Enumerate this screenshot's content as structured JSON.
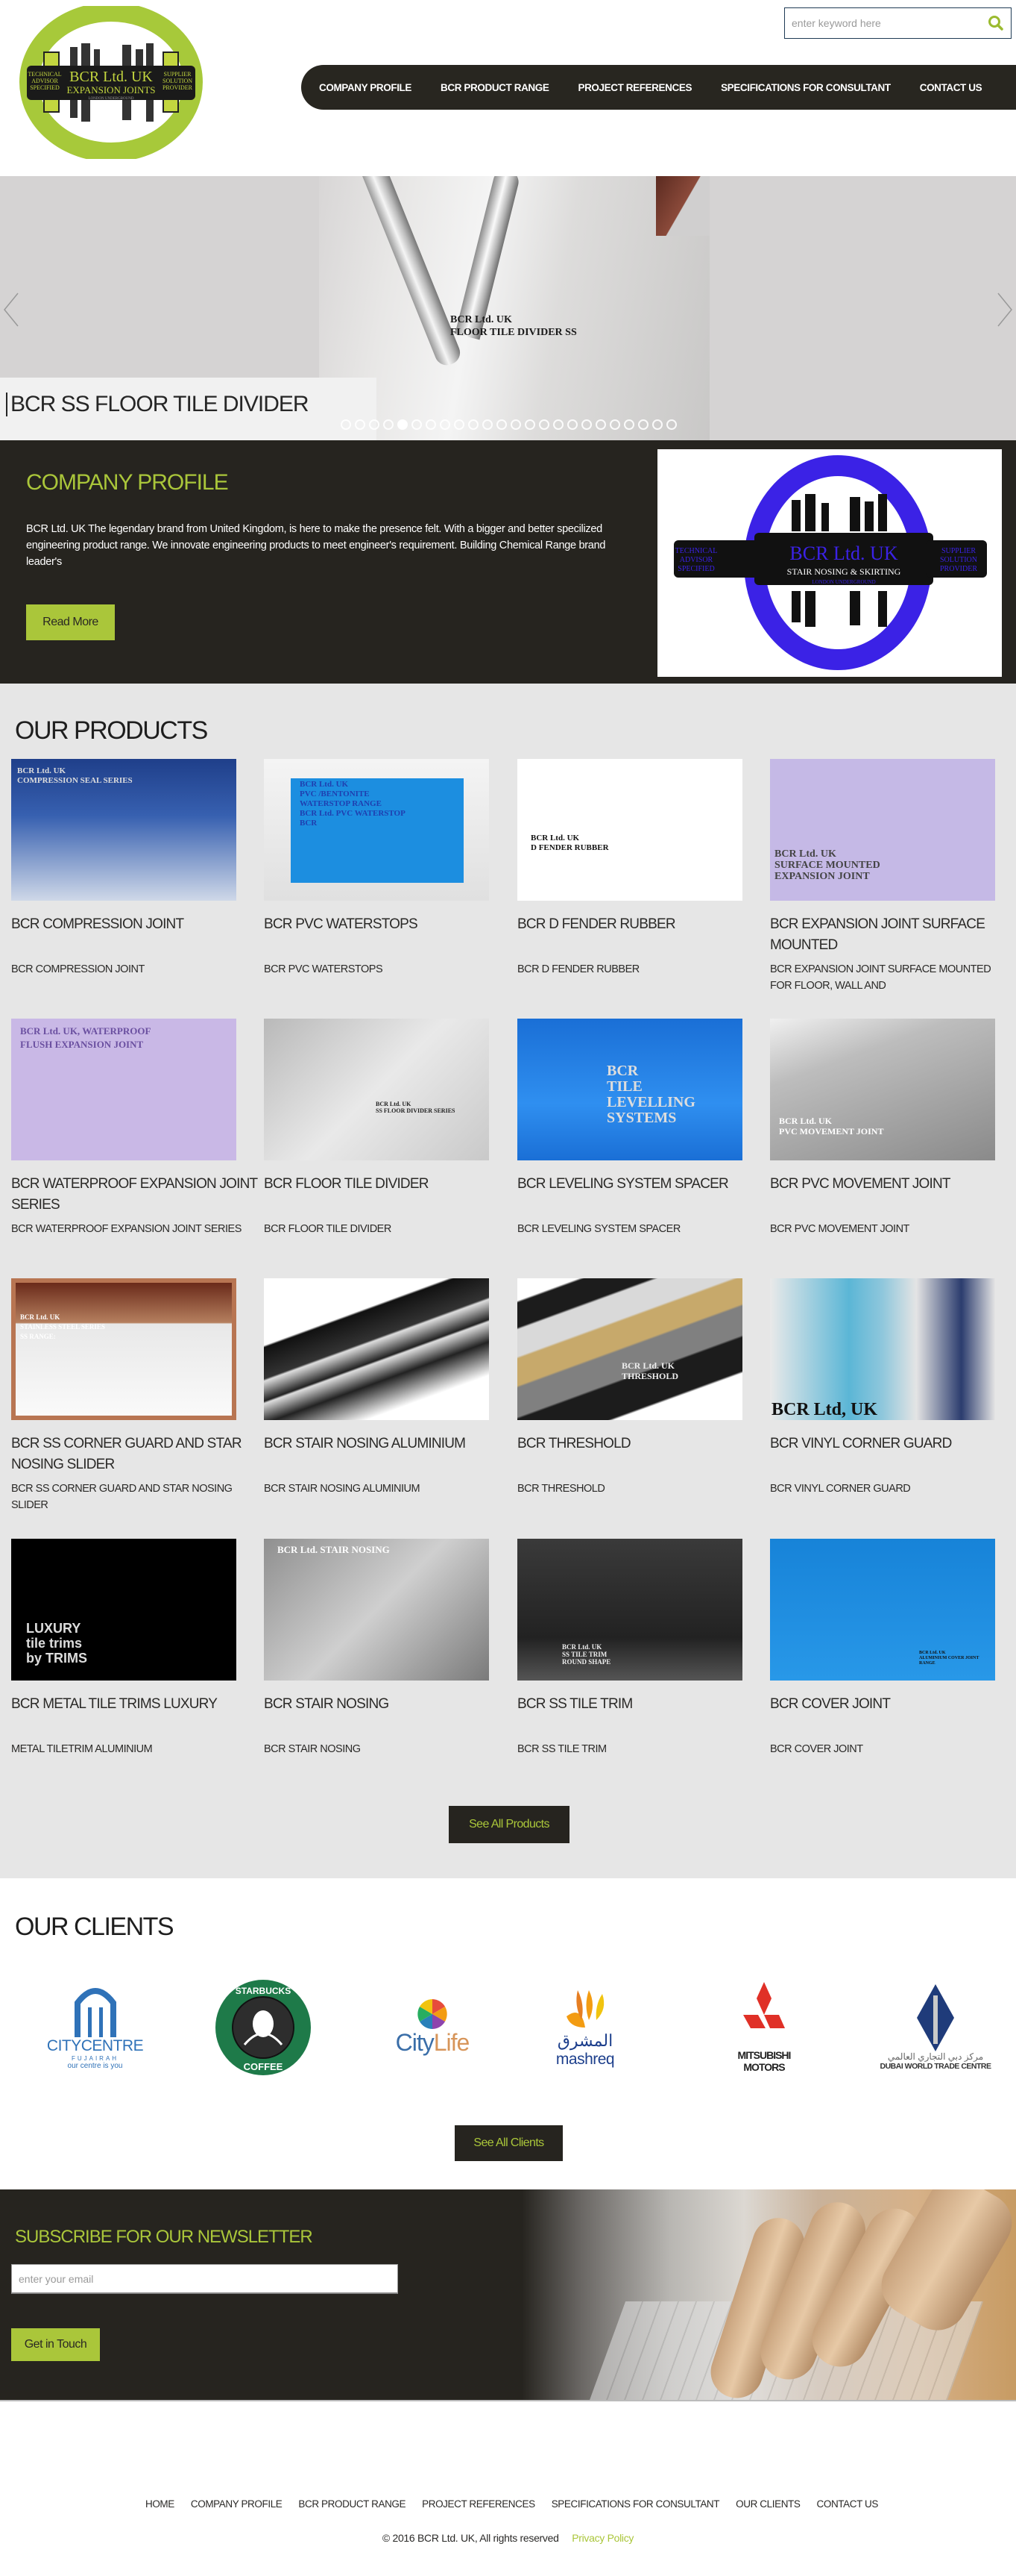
{
  "header": {
    "logo": {
      "title": "BCR Ltd. UK",
      "subtitle": "EXPANSION JOINTS",
      "tagline": "LONDON UNDERGROUND",
      "left_text": [
        "TECHNICAL",
        "ADVISOR",
        "SPECIFIED"
      ],
      "right_text": [
        "SUPPLIER",
        "SOLUTION",
        "PROVIDER"
      ]
    },
    "search": {
      "placeholder": "enter keyword here",
      "icon": "search-icon"
    },
    "nav": [
      {
        "label": "COMPANY PROFILE"
      },
      {
        "label": "BCR PRODUCT RANGE"
      },
      {
        "label": "PROJECT REFERENCES"
      },
      {
        "label": "SPECIFICATIONS FOR CONSULTANT"
      },
      {
        "label": "CONTACT US"
      }
    ]
  },
  "slider": {
    "image_text": [
      "BCR Ltd. UK",
      "FLOOR TILE DIVIDER SS"
    ],
    "caption": "BCR SS FLOOR TILE DIVIDER",
    "prev_icon": "chevron-left-icon",
    "next_icon": "chevron-right-icon",
    "dot_count": 24,
    "active_dot": 4
  },
  "profile": {
    "title": "COMPANY PROFILE",
    "text": "BCR Ltd. UK The legendary brand from United Kingdom, is here to make the presence felt. With a bigger and better specilized engineering product range. We innovate engineering products to meet engineer's requirement. Building Chemical Range brand leader's",
    "button": "Read More",
    "logo": {
      "title": "BCR Ltd. UK",
      "subtitle": "STAIR NOSING & SKIRTING",
      "tagline": "LONDON UNDERGROUND",
      "left_text": [
        "TECHNICAL",
        "ADVISOR",
        "SPECIFIED"
      ],
      "right_text": [
        "SUPPLIER",
        "SOLUTION",
        "PROVIDER"
      ]
    }
  },
  "products": {
    "title": "OUR PRODUCTS",
    "items": [
      {
        "title": "BCR COMPRESSION JOINT",
        "desc": "BCR COMPRESSION JOINT",
        "img_text": [
          "BCR Ltd. UK",
          "COMPRESSION SEAL SERIES"
        ]
      },
      {
        "title": "BCR PVC WATERSTOPS",
        "desc": "BCR PVC WATERSTOPS",
        "img_text": [
          "BCR Ltd. UK",
          "PVC /BENTONITE",
          "WATERSTOP RANGE",
          "BCR Ltd. PVC WATERSTOP",
          "BCR"
        ]
      },
      {
        "title": "BCR D FENDER RUBBER",
        "desc": "BCR D FENDER RUBBER",
        "img_text": [
          "BCR Ltd. UK",
          "D FENDER RUBBER"
        ]
      },
      {
        "title": "BCR EXPANSION JOINT SURFACE MOUNTED",
        "desc": "BCR EXPANSION JOINT SURFACE MOUNTED FOR FLOOR, WALL AND",
        "img_text": [
          "BCR Ltd. UK",
          "SURFACE MOUNTED",
          "EXPANSION JOINT"
        ]
      },
      {
        "title": "BCR WATERPROOF EXPANSION JOINT SERIES",
        "desc": "BCR WATERPROOF EXPANSION JOINT SERIES",
        "img_text": [
          "BCR Ltd. UK, WATERPROOF",
          "FLUSH EXPANSION JOINT"
        ]
      },
      {
        "title": "BCR FLOOR TILE DIVIDER",
        "desc": "BCR FLOOR TILE DIVIDER",
        "img_text": [
          "BCR Ltd. UK",
          "SS FLOOR DIVIDER SERIES"
        ]
      },
      {
        "title": "BCR LEVELING SYSTEM SPACER",
        "desc": "BCR LEVELING SYSTEM SPACER",
        "img_text": [
          "BCR",
          "TILE",
          "LEVELLING",
          "SYSTEMS"
        ]
      },
      {
        "title": "BCR PVC MOVEMENT JOINT",
        "desc": "BCR PVC MOVEMENT JOINT",
        "img_text": [
          "BCR Ltd. UK",
          "PVC MOVEMENT JOINT"
        ]
      },
      {
        "title": "BCR SS CORNER GUARD AND STAR NOSING SLIDER",
        "desc": "BCR SS CORNER GUARD AND STAR NOSING SLIDER",
        "img_text": [
          "BCR Ltd. UK",
          "STAINLESS STEEL SERIES",
          "SS RANGE:"
        ]
      },
      {
        "title": "BCR STAIR NOSING ALUMINIUM",
        "desc": "BCR STAIR NOSING ALUMINIUM",
        "img_text": []
      },
      {
        "title": "BCR THRESHOLD",
        "desc": "BCR THRESHOLD",
        "img_text": [
          "BCR Ltd. UK",
          "THRESHOLD"
        ]
      },
      {
        "title": "BCR VINYL CORNER GUARD",
        "desc": "BCR VINYL CORNER GUARD",
        "img_text": [
          "BCR Ltd, UK"
        ]
      },
      {
        "title": "BCR METAL TILE TRIMS LUXURY",
        "desc": "METAL TILETRIM ALUMINIUM",
        "img_text": [
          "LUXURY",
          "tile trims",
          "by TRIMS"
        ]
      },
      {
        "title": "BCR STAIR NOSING",
        "desc": "BCR STAIR NOSING",
        "img_text": [
          "BCR Ltd. STAIR NOSING"
        ]
      },
      {
        "title": "BCR SS TILE TRIM",
        "desc": "BCR SS TILE TRIM",
        "img_text": [
          "BCR Ltd. UK",
          "SS TILE TRIM",
          "ROUND SHAPE"
        ]
      },
      {
        "title": "BCR COVER JOINT",
        "desc": "BCR COVER JOINT",
        "img_text": [
          "BCR Ltd. UK",
          "ALUMINIUM COVER JOINT RANGE"
        ]
      }
    ],
    "see_all": "See All Products"
  },
  "clients": {
    "title": "OUR CLIENTS",
    "logos": [
      {
        "name": "CITYCENTRE",
        "sub": "FUJAIRAH",
        "tagline": "our centre is you"
      },
      {
        "name": "STARBUCKS COFFEE"
      },
      {
        "name": "CityLife"
      },
      {
        "name": "mashreq",
        "arabic": "المشرق"
      },
      {
        "name": "MITSUBISHI",
        "sub": "MOTORS"
      },
      {
        "name": "DUBAI WORLD TRADE CENTRE",
        "arabic": "مركز دبي التجاري العالمي"
      }
    ],
    "see_all": "See All Clients"
  },
  "newsletter": {
    "title": "SUBSCRIBE FOR OUR NEWSLETTER",
    "placeholder": "enter your email",
    "button": "Get in Touch"
  },
  "footer": {
    "nav": [
      {
        "label": "HOME"
      },
      {
        "label": "COMPANY PROFILE"
      },
      {
        "label": "BCR PRODUCT RANGE"
      },
      {
        "label": "PROJECT REFERENCES"
      },
      {
        "label": "SPECIFICATIONS FOR CONSULTANT"
      },
      {
        "label": "OUR CLIENTS"
      },
      {
        "label": "CONTACT US"
      }
    ],
    "copyright": "© 2016 BCR Ltd. UK, All rights reserved",
    "privacy": "Privacy Policy"
  },
  "colors": {
    "accent_green": "#aac63a",
    "dark": "#26241f",
    "products_bg": "#e6e6e6",
    "search_border": "#1f3b55",
    "profile_logo_ring": "#3b22e6"
  }
}
